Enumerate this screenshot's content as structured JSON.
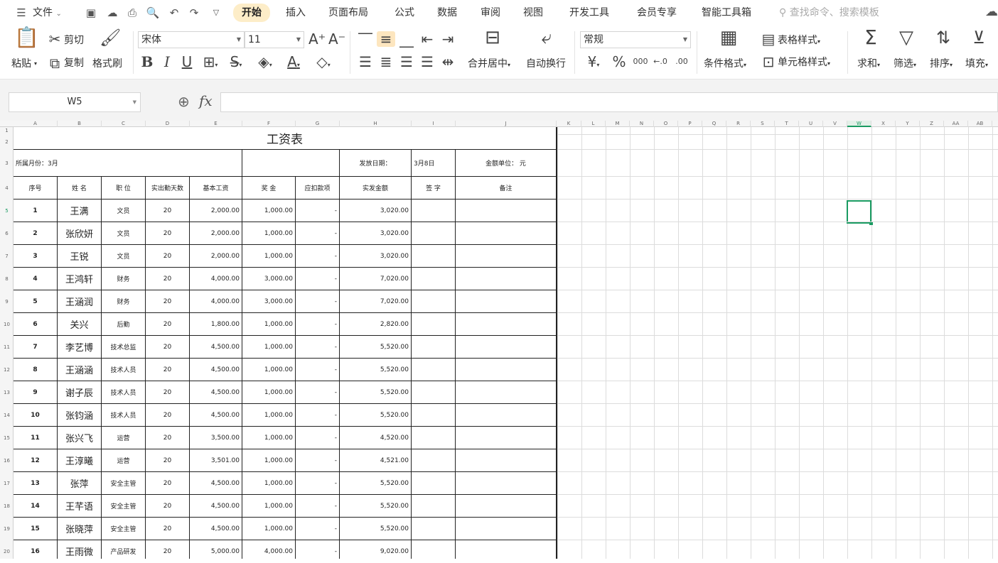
{
  "menubar": {
    "file_label": "文件",
    "tabs": [
      "开始",
      "插入",
      "页面布局",
      "公式",
      "数据",
      "审阅",
      "视图",
      "开发工具",
      "会员专享",
      "智能工具箱"
    ],
    "search_placeholder": "查找命令、搜索模板"
  },
  "ribbon": {
    "paste": "粘贴",
    "cut": "剪切",
    "copy": "复制",
    "format_painter": "格式刷",
    "font_name": "宋体",
    "font_size": "11",
    "merge": "合并居中",
    "wrap": "自动换行",
    "number_format": "常规",
    "conditional": "条件格式",
    "table_style": "表格样式",
    "cell_style": "单元格样式",
    "sum": "求和",
    "filter": "筛选",
    "sort": "排序",
    "fill": "填充",
    "bold": "B",
    "italic": "I",
    "underline": "U",
    "percent": "%",
    "thousands": "000",
    "currency": "¥"
  },
  "formula_bar": {
    "name_box": "W5",
    "fx": "fx",
    "content": ""
  },
  "columns": [
    "A",
    "B",
    "C",
    "D",
    "E",
    "F",
    "G",
    "H",
    "I",
    "J",
    "K",
    "L",
    "M",
    "N",
    "O",
    "P",
    "Q",
    "R",
    "S",
    "T",
    "U",
    "V",
    "W",
    "X",
    "Y",
    "Z",
    "AA",
    "AB"
  ],
  "selected_column": "W",
  "selected_row": "5",
  "rows": [
    "1",
    "2",
    "3",
    "4",
    "5",
    "6",
    "7",
    "8",
    "9",
    "10",
    "11",
    "12",
    "13",
    "14",
    "15",
    "16",
    "17",
    "18",
    "19",
    "20"
  ],
  "sheet": {
    "title": "工资表",
    "month_label": "所属月份：3月",
    "date_label": "发放日期：",
    "date_value": "3月8日",
    "unit_label": "金额单位：  元",
    "headers": [
      "序号",
      "姓 名",
      "职 位",
      "实出勤天数",
      "基本工资",
      "奖 金",
      "应扣款项",
      "实发金额",
      "签 字",
      "备注"
    ],
    "records": [
      {
        "no": "1",
        "name": "王满",
        "pos": "文员",
        "days": "20",
        "base": "2,000.00",
        "bonus": "1,000.00",
        "ded": "-",
        "net": "3,020.00"
      },
      {
        "no": "2",
        "name": "张欣妍",
        "pos": "文员",
        "days": "20",
        "base": "2,000.00",
        "bonus": "1,000.00",
        "ded": "-",
        "net": "3,020.00"
      },
      {
        "no": "3",
        "name": "王锐",
        "pos": "文员",
        "days": "20",
        "base": "2,000.00",
        "bonus": "1,000.00",
        "ded": "-",
        "net": "3,020.00"
      },
      {
        "no": "4",
        "name": "王鸿轩",
        "pos": "财务",
        "days": "20",
        "base": "4,000.00",
        "bonus": "3,000.00",
        "ded": "-",
        "net": "7,020.00"
      },
      {
        "no": "5",
        "name": "王涵润",
        "pos": "财务",
        "days": "20",
        "base": "4,000.00",
        "bonus": "3,000.00",
        "ded": "-",
        "net": "7,020.00"
      },
      {
        "no": "6",
        "name": "关兴",
        "pos": "后勤",
        "days": "20",
        "base": "1,800.00",
        "bonus": "1,000.00",
        "ded": "-",
        "net": "2,820.00"
      },
      {
        "no": "7",
        "name": "李艺博",
        "pos": "技术总监",
        "days": "20",
        "base": "4,500.00",
        "bonus": "1,000.00",
        "ded": "-",
        "net": "5,520.00"
      },
      {
        "no": "8",
        "name": "王涵涵",
        "pos": "技术人员",
        "days": "20",
        "base": "4,500.00",
        "bonus": "1,000.00",
        "ded": "-",
        "net": "5,520.00"
      },
      {
        "no": "9",
        "name": "谢子辰",
        "pos": "技术人员",
        "days": "20",
        "base": "4,500.00",
        "bonus": "1,000.00",
        "ded": "-",
        "net": "5,520.00"
      },
      {
        "no": "10",
        "name": "张钧涵",
        "pos": "技术人员",
        "days": "20",
        "base": "4,500.00",
        "bonus": "1,000.00",
        "ded": "-",
        "net": "5,520.00"
      },
      {
        "no": "11",
        "name": "张兴飞",
        "pos": "运营",
        "days": "20",
        "base": "3,500.00",
        "bonus": "1,000.00",
        "ded": "-",
        "net": "4,520.00"
      },
      {
        "no": "12",
        "name": "王淳曦",
        "pos": "运营",
        "days": "20",
        "base": "3,501.00",
        "bonus": "1,000.00",
        "ded": "-",
        "net": "4,521.00"
      },
      {
        "no": "13",
        "name": "张萍",
        "pos": "安全主管",
        "days": "20",
        "base": "4,500.00",
        "bonus": "1,000.00",
        "ded": "-",
        "net": "5,520.00"
      },
      {
        "no": "14",
        "name": "王芊语",
        "pos": "安全主管",
        "days": "20",
        "base": "4,500.00",
        "bonus": "1,000.00",
        "ded": "-",
        "net": "5,520.00"
      },
      {
        "no": "15",
        "name": "张晓萍",
        "pos": "安全主管",
        "days": "20",
        "base": "4,500.00",
        "bonus": "1,000.00",
        "ded": "-",
        "net": "5,520.00"
      },
      {
        "no": "16",
        "name": "王雨微",
        "pos": "产品研发",
        "days": "20",
        "base": "5,000.00",
        "bonus": "4,000.00",
        "ded": "-",
        "net": "9,020.00"
      }
    ]
  }
}
